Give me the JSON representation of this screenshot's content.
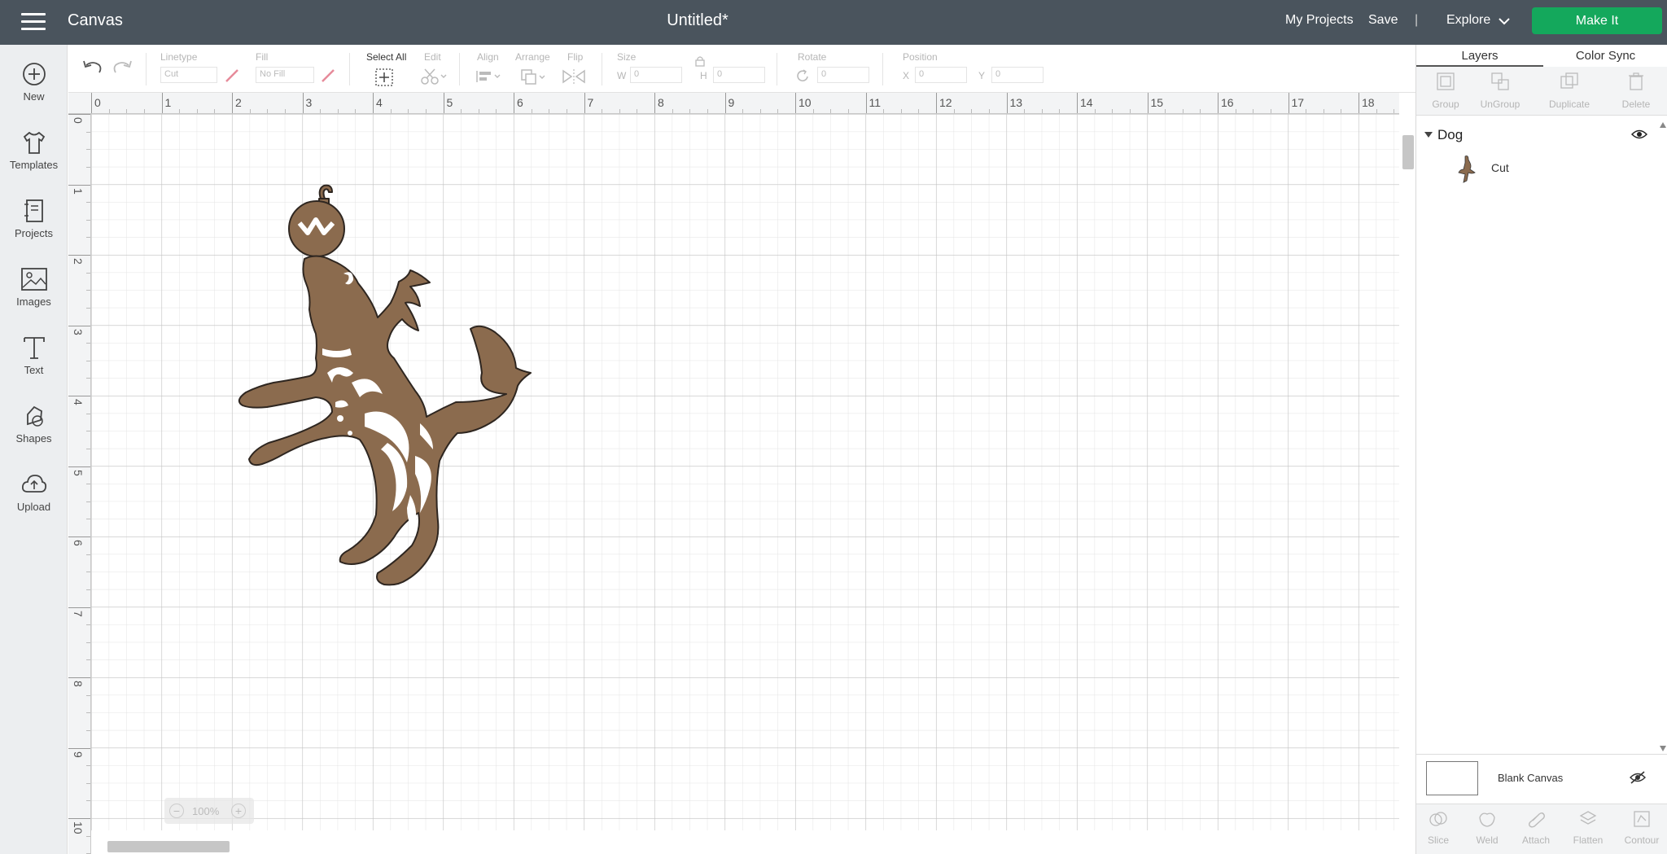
{
  "header": {
    "app_title": "Canvas",
    "doc_title": "Untitled*",
    "my_projects": "My Projects",
    "save": "Save",
    "divider": "|",
    "explore": "Explore",
    "make_it": "Make It"
  },
  "sidebar": {
    "items": [
      {
        "label": "New",
        "icon": "plus-circle-icon"
      },
      {
        "label": "Templates",
        "icon": "tshirt-icon"
      },
      {
        "label": "Projects",
        "icon": "notebook-icon"
      },
      {
        "label": "Images",
        "icon": "image-icon"
      },
      {
        "label": "Text",
        "icon": "text-t-icon"
      },
      {
        "label": "Shapes",
        "icon": "shapes-icon"
      },
      {
        "label": "Upload",
        "icon": "cloud-upload-icon"
      }
    ]
  },
  "toolbar": {
    "linetype_label": "Linetype",
    "linetype_value": "Cut",
    "fill_label": "Fill",
    "fill_value": "No Fill",
    "select_all": "Select All",
    "edit": "Edit",
    "align": "Align",
    "arrange": "Arrange",
    "flip": "Flip",
    "size": "Size",
    "w": "W",
    "w_value": "0",
    "h": "H",
    "h_value": "0",
    "rotate": "Rotate",
    "rotate_value": "0",
    "position": "Position",
    "x": "X",
    "x_value": "0",
    "y": "Y",
    "y_value": "0"
  },
  "ruler": {
    "top": [
      "0",
      "1",
      "2",
      "3",
      "4",
      "5",
      "6",
      "7",
      "8",
      "9",
      "10",
      "11",
      "12",
      "13",
      "14",
      "15",
      "16",
      "17",
      "18"
    ],
    "left": [
      "0",
      "1",
      "2",
      "3",
      "4",
      "5",
      "6",
      "7",
      "8",
      "9",
      "10"
    ]
  },
  "zoom": {
    "value": "100%",
    "minus": "−",
    "plus": "+"
  },
  "panel": {
    "tab_layers": "Layers",
    "tab_color_sync": "Color Sync",
    "tools": [
      "Group",
      "UnGroup",
      "Duplicate",
      "Delete"
    ],
    "group_name": "Dog",
    "layer_name": "Cut",
    "blank_canvas": "Blank Canvas",
    "bottom_tools": [
      "Slice",
      "Weld",
      "Attach",
      "Flatten",
      "Contour"
    ]
  },
  "colors": {
    "topbar": "#4a545d",
    "accent": "#14a85c",
    "dog_fill": "#8b6b4e"
  }
}
